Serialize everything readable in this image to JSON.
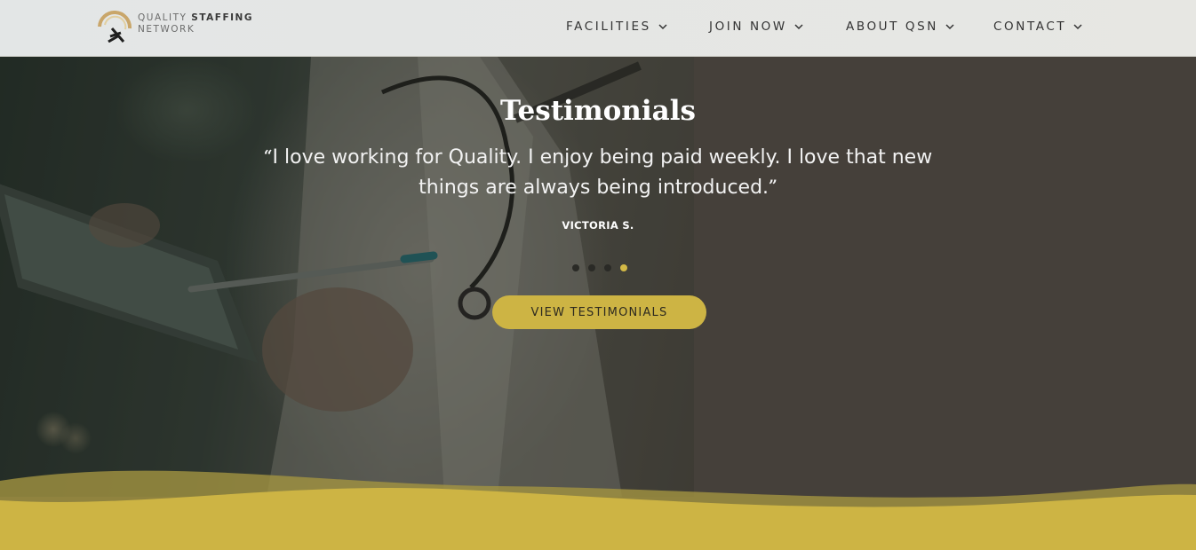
{
  "brand": {
    "line1_light": "QUALITY",
    "line1_bold": "STAFFING",
    "line2": "NETWORK",
    "accent_color": "#cdb444"
  },
  "nav": {
    "items": [
      {
        "label": "FACILITIES",
        "icon": "chevron-down-icon"
      },
      {
        "label": "JOIN NOW",
        "icon": "chevron-down-icon"
      },
      {
        "label": "ABOUT QSN",
        "icon": "chevron-down-icon"
      },
      {
        "label": "CONTACT",
        "icon": "chevron-down-icon"
      }
    ]
  },
  "testimonials": {
    "title": "Testimonials",
    "quote": "I love working for Quality. I enjoy being paid weekly. I love that new things are always being introduced.",
    "author": "VICTORIA S.",
    "slide_count": 4,
    "active_slide": 4,
    "button_label": "VIEW TESTIMONIALS"
  },
  "colors": {
    "panel": "#45403a",
    "gold": "#cdb444",
    "header_bg": "#e5e6e4"
  }
}
